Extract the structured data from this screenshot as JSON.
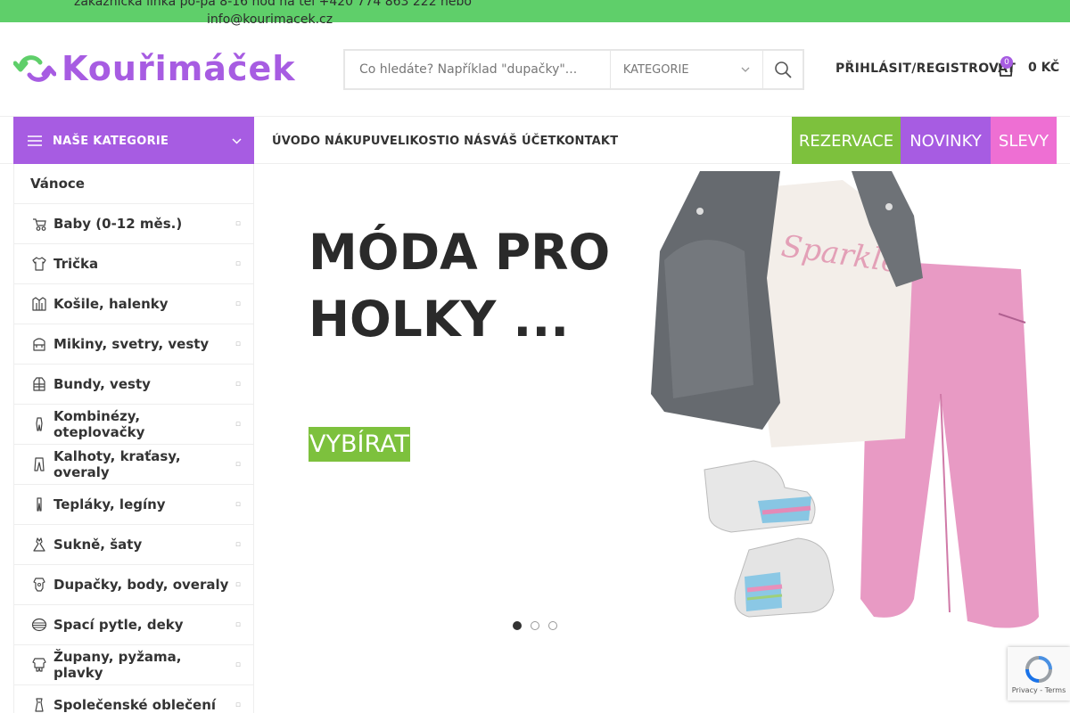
{
  "topbar": {
    "line1": "zákaznická linka po-pá 8-16 hod na tel +420 774 863 222 nebo",
    "line2": "info@kourimacek.cz"
  },
  "logo": {
    "text": "Kouřimáček"
  },
  "search": {
    "placeholder": "Co hledáte? Například \"dupačky\"...",
    "category_label": "KATEGORIE"
  },
  "header": {
    "login_label": "PŘIHLÁSIT/REGISTROVAT",
    "cart_count": "0",
    "cart_total": "0 KČ"
  },
  "nav": {
    "categories_label": "NAŠE KATEGORIE",
    "links": [
      "ÚVOD",
      "O NÁKUPU",
      "VELIKOSTI",
      "O NÁS",
      "VÁŠ ÚČET",
      "KONTAKT"
    ],
    "reservations": "REZERVACE",
    "news": "NOVINKY",
    "sale": "SLEVY"
  },
  "sidebar": {
    "items": [
      {
        "label": "Vánoce",
        "icon": "none"
      },
      {
        "label": "Baby (0-12 měs.)",
        "icon": "stroller-icon"
      },
      {
        "label": "Trička",
        "icon": "tshirt-icon"
      },
      {
        "label": "Košile, halenky",
        "icon": "shirt-icon"
      },
      {
        "label": "Mikiny, svetry, vesty",
        "icon": "sweater-icon"
      },
      {
        "label": "Bundy, vesty",
        "icon": "jacket-icon"
      },
      {
        "label": "Kombinézy, oteplovačky",
        "icon": "snowsuit-icon"
      },
      {
        "label": "Kalhoty, kraťasy, overaly",
        "icon": "pants-icon"
      },
      {
        "label": "Tepláky, legíny",
        "icon": "leggings-icon"
      },
      {
        "label": "Sukně, šaty",
        "icon": "dress-icon"
      },
      {
        "label": "Dupačky, body, overaly",
        "icon": "bodysuit-icon"
      },
      {
        "label": "Spací pytle, deky",
        "icon": "blanket-icon"
      },
      {
        "label": "Župany, pyžama, plavky",
        "icon": "pajamas-icon"
      },
      {
        "label": "Společenské oblečení",
        "icon": "formal-icon"
      }
    ]
  },
  "hero": {
    "title_line1": "MÓDA PRO",
    "title_line2": "HOLKY ...",
    "button": "VYBÍRAT",
    "slide_count": 3,
    "active_slide": 1
  },
  "recaptcha": {
    "text": "Privacy - Terms"
  },
  "colors": {
    "topbar": "#5fcf6a",
    "brand_purple": "#a75ce2",
    "green": "#7dc13d",
    "pink": "#ee6fd3"
  }
}
